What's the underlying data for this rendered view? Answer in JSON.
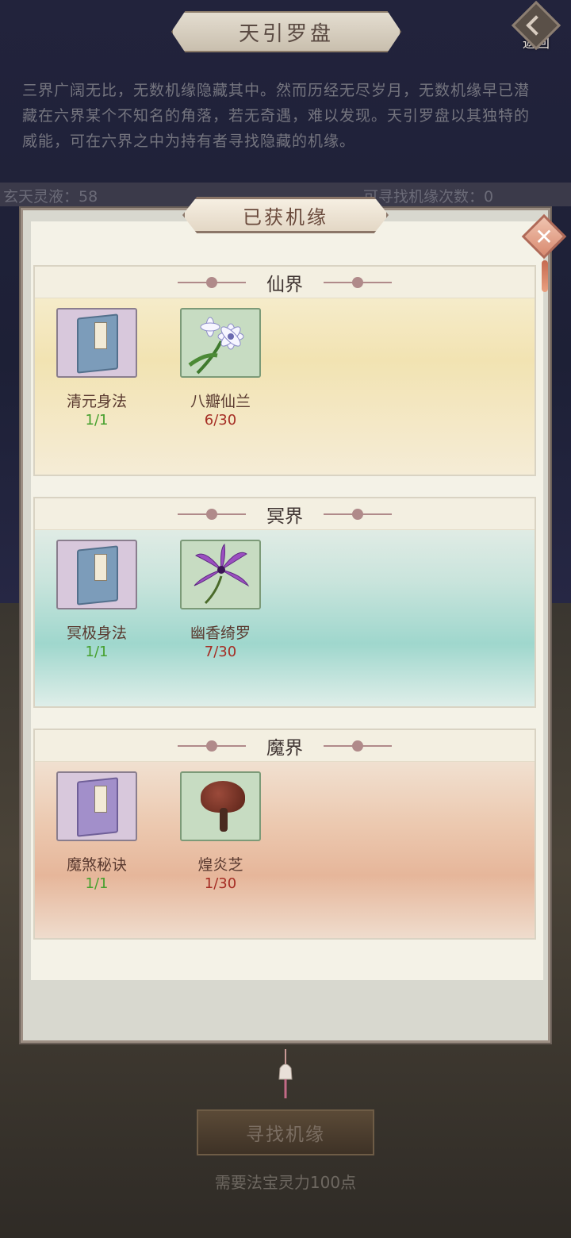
{
  "header": {
    "title": "天引罗盘",
    "back_label": "返回"
  },
  "intro": "三界广阔无比，无数机缘隐藏其中。然而历经无尽岁月，无数机缘早已潜藏在六界某个不知名的角落，若无奇遇，难以发现。天引罗盘以其独特的威能，可在六界之中为持有者寻找隐藏的机缘。",
  "stats": {
    "left": "玄天灵液：58",
    "right": "可寻找机缘次数：0"
  },
  "panel": {
    "title": "已获机缘",
    "realms": [
      {
        "name": "仙界",
        "items": [
          {
            "name": "清元身法",
            "count": "1/1"
          },
          {
            "name": "八瓣仙兰",
            "count": "6/30"
          }
        ]
      },
      {
        "name": "冥界",
        "items": [
          {
            "name": "冥极身法",
            "count": "1/1"
          },
          {
            "name": "幽香绮罗",
            "count": "7/30"
          }
        ]
      },
      {
        "name": "魔界",
        "items": [
          {
            "name": "魔煞秘诀",
            "count": "1/1"
          },
          {
            "name": "煌炎芝",
            "count": "1/30"
          }
        ]
      }
    ]
  },
  "footer": {
    "seek_button": "寻找机缘",
    "requirement": "需要法宝灵力100点"
  },
  "colors": {
    "complete": "#46a02e",
    "in_progress": "#a52d24"
  },
  "icons": [
    "back-icon",
    "close-icon",
    "skill-book-icon",
    "orchid-icon",
    "purple-flower-icon",
    "lingzhi-icon"
  ]
}
